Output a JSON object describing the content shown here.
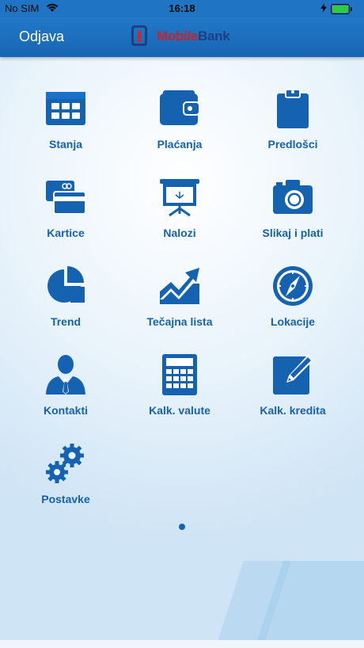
{
  "status_bar": {
    "carrier": "No SIM",
    "time": "16:18"
  },
  "nav": {
    "logout_label": "Odjava",
    "logo_text_left": "Mobile",
    "logo_text_right": "Bank"
  },
  "colors": {
    "nav_bg": "#1f74c4",
    "accent": "#1462b0",
    "brand_red": "#c8232a",
    "brand_navy": "#1d3f86"
  },
  "menu": [
    {
      "label": "Stanja",
      "icon": "accounts-grid-icon"
    },
    {
      "label": "Plaćanja",
      "icon": "wallet-icon"
    },
    {
      "label": "Predlošci",
      "icon": "clipboard-icon"
    },
    {
      "label": "Kartice",
      "icon": "cards-icon"
    },
    {
      "label": "Nalozi",
      "icon": "presentation-board-icon"
    },
    {
      "label": "Slikaj i plati",
      "icon": "camera-icon"
    },
    {
      "label": "Trend",
      "icon": "pie-chart-icon"
    },
    {
      "label": "Tečajna lista",
      "icon": "trend-chart-icon"
    },
    {
      "label": "Lokacije",
      "icon": "compass-icon"
    },
    {
      "label": "Kontakti",
      "icon": "contact-person-icon"
    },
    {
      "label": "Kalk. valute",
      "icon": "calculator-icon"
    },
    {
      "label": "Kalk. kredita",
      "icon": "edit-note-icon"
    },
    {
      "label": "Postavke",
      "icon": "gears-icon"
    }
  ]
}
